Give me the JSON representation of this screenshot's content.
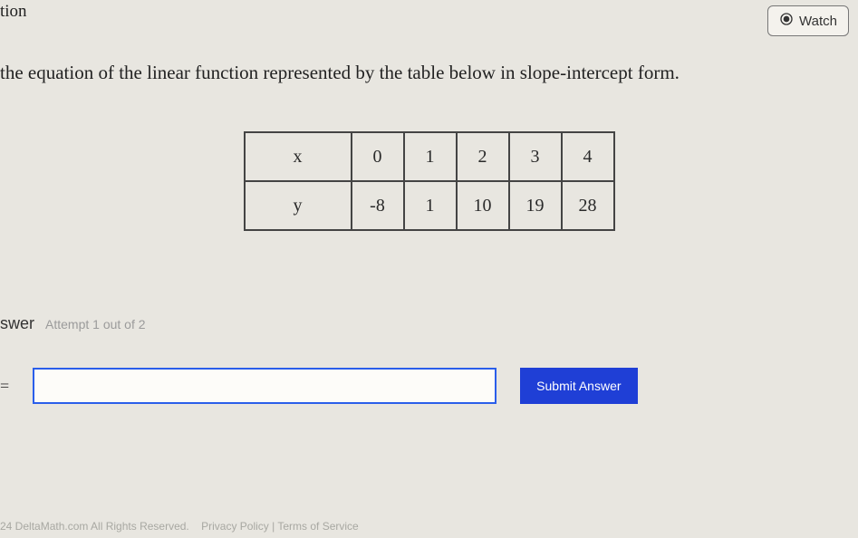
{
  "header": {
    "tion": "tion",
    "watch_label": "Watch"
  },
  "question": {
    "prompt": "the equation of the linear function represented by the table below in slope-intercept form."
  },
  "table": {
    "row_labels": [
      "x",
      "y"
    ],
    "x": [
      "0",
      "1",
      "2",
      "3",
      "4"
    ],
    "y": [
      "-8",
      "1",
      "10",
      "19",
      "28"
    ]
  },
  "answer": {
    "swer_label": "swer",
    "attempt_label": "Attempt 1 out of 2",
    "prefix": "=",
    "input_value": "",
    "submit_label": "Submit Answer"
  },
  "footer": {
    "copyright": "24 DeltaMath.com All Rights Reserved.",
    "privacy": "Privacy Policy",
    "sep": " | ",
    "terms": "Terms of Service"
  },
  "chart_data": {
    "type": "table",
    "columns": [
      "x",
      "y"
    ],
    "rows": [
      [
        0,
        -8
      ],
      [
        1,
        1
      ],
      [
        2,
        10
      ],
      [
        3,
        19
      ],
      [
        4,
        28
      ]
    ]
  }
}
